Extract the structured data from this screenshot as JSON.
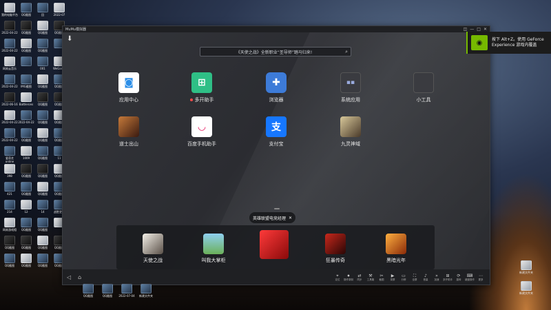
{
  "window": {
    "title": "MuMu模拟器",
    "controls": [
      "◫",
      "—",
      "□",
      "✕"
    ]
  },
  "search": {
    "placeholder": "《天使之战》全新职业“圣导师”踏马归来!"
  },
  "apps": [
    {
      "label": "应用中心",
      "icon": "app-center-icon",
      "color": "#ffffff"
    },
    {
      "label": "多开助手",
      "icon": "multi-instance-icon",
      "color": "#2fbf86",
      "badge": true
    },
    {
      "label": "浏览器",
      "icon": "browser-icon",
      "color": "#3d7bd8"
    },
    {
      "label": "系统应用",
      "icon": "system-apps-icon",
      "color": "#3a3b40"
    },
    {
      "label": "小工具",
      "icon": "tools-icon",
      "color": "#3a3b40"
    },
    {
      "label": "道士出山",
      "icon": "game-icon",
      "color": "#7a3a2a"
    },
    {
      "label": "百度手机助手",
      "icon": "baidu-assistant-icon",
      "color": "#ffffff"
    },
    {
      "label": "支付宝",
      "icon": "alipay-icon",
      "color": "#1677ff"
    },
    {
      "label": "九灵神域",
      "icon": "game-icon",
      "color": "#8a7a5a"
    }
  ],
  "tooltip": {
    "text": "英雄联盟电竞经理",
    "close": "✕"
  },
  "dock": [
    {
      "label": "天使之战",
      "color": "#e8e4dc"
    },
    {
      "label": "叫我大掌柜",
      "color": "#6bb05a"
    },
    {
      "label": "英雄联盟电竞经理",
      "label_display": "",
      "color": "#d8262a"
    },
    {
      "label": "狂暴传奇",
      "color": "#8b1a14"
    },
    {
      "label": "黑暗光年",
      "color": "#c4561c"
    }
  ],
  "bottom_tools": [
    "定位",
    "操作录制",
    "同步",
    "工具箱",
    "截图",
    "录屏",
    "分辨",
    "全屏",
    "音量",
    "加速",
    "多开助手",
    "旋转",
    "键盘操作",
    "更多"
  ],
  "notification": {
    "text_line1": "按下 Alt+Z。使用 GeForce",
    "text_line2": "Experience 游戏内覆盖"
  },
  "desktop_icons": [
    "我的电脑平台",
    "QQ截图",
    "回",
    "2022-07",
    "QQ截图",
    "2022-04-22",
    "QQ截图",
    "QQ截图",
    "QQ截图",
    "",
    "2022-04-22",
    "QQ截图",
    "QQ截图",
    "",
    "",
    "网易云音乐",
    "",
    "001",
    "WeGame",
    "",
    "2022-04-22",
    "IMG截图",
    "QQ截图",
    "QQ截图",
    "",
    "2022-06-16",
    "Battlerons",
    "QQ截图",
    "QQ截图",
    "",
    "2022-04-22",
    "2022-04-22",
    "QQ截图",
    "QQ截图",
    "",
    "2022-04-22",
    "QQ截图",
    "QQ截图",
    "QQ截图",
    "",
    "爱奇艺online",
    "1009",
    "QQ截图",
    "11",
    "",
    "398",
    "QQ截图",
    "QQ截图",
    "QQ截图",
    "",
    "421",
    "QQ截图",
    "QQ截图",
    "QQ截图",
    "",
    "214",
    "12",
    "14",
    "战胜更改",
    "",
    "网易游戏相",
    "QQ截图",
    "QQ截图",
    "",
    "",
    "QQ截图",
    "QQ截图",
    "QQ截图",
    "QQ截图",
    "",
    "QQ截图",
    "QQ截图",
    "QQ截图",
    "QQ截图",
    ""
  ],
  "taskbar_items": [
    "QQ截图",
    "QQ截图",
    "2022-07-04",
    "新建文件夹"
  ],
  "right_desktop": [
    "新建文件夹",
    "新建文件夹"
  ]
}
